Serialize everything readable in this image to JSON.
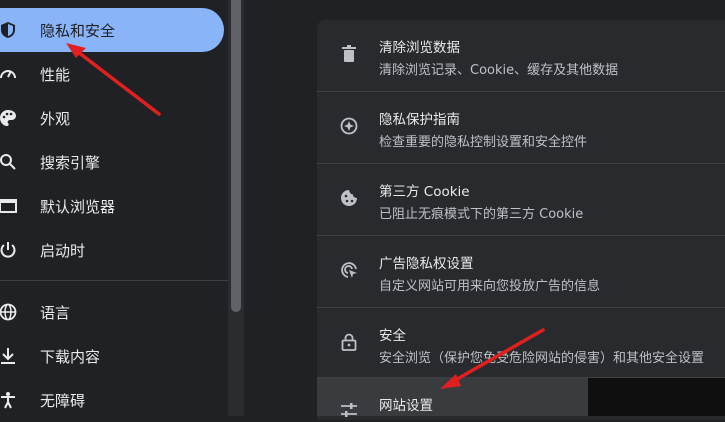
{
  "sidebar": {
    "items": [
      {
        "label": "隐私和安全",
        "icon": "shield-icon",
        "active": true
      },
      {
        "label": "性能",
        "icon": "speedometer-icon"
      },
      {
        "label": "外观",
        "icon": "palette-icon"
      },
      {
        "label": "搜索引擎",
        "icon": "search-icon"
      },
      {
        "label": "默认浏览器",
        "icon": "browser-window-icon"
      },
      {
        "label": "启动时",
        "icon": "power-icon"
      },
      {
        "label": "语言",
        "icon": "globe-icon"
      },
      {
        "label": "下载内容",
        "icon": "download-icon"
      },
      {
        "label": "无障碍",
        "icon": "accessibility-icon"
      }
    ]
  },
  "privacy": {
    "rows": [
      {
        "title": "清除浏览数据",
        "desc": "清除浏览记录、Cookie、缓存及其他数据",
        "icon": "trash-icon"
      },
      {
        "title": "隐私保护指南",
        "desc": "检查重要的隐私控制设置和安全控件",
        "icon": "compass-icon"
      },
      {
        "title": "第三方 Cookie",
        "desc": "已阻止无痕模式下的第三方 Cookie",
        "icon": "cookie-icon"
      },
      {
        "title": "广告隐私权设置",
        "desc": "自定义网站可用来向您投放广告的信息",
        "icon": "ad-privacy-icon"
      },
      {
        "title": "安全",
        "desc": "安全浏览（保护您免受危险网站的侵害）和其他安全设置",
        "icon": "lock-icon"
      },
      {
        "title": "网站设置",
        "desc": "",
        "icon": "sliders-icon"
      }
    ]
  },
  "colors": {
    "accent": "#8ab4f8",
    "arrow": "#e02020"
  }
}
